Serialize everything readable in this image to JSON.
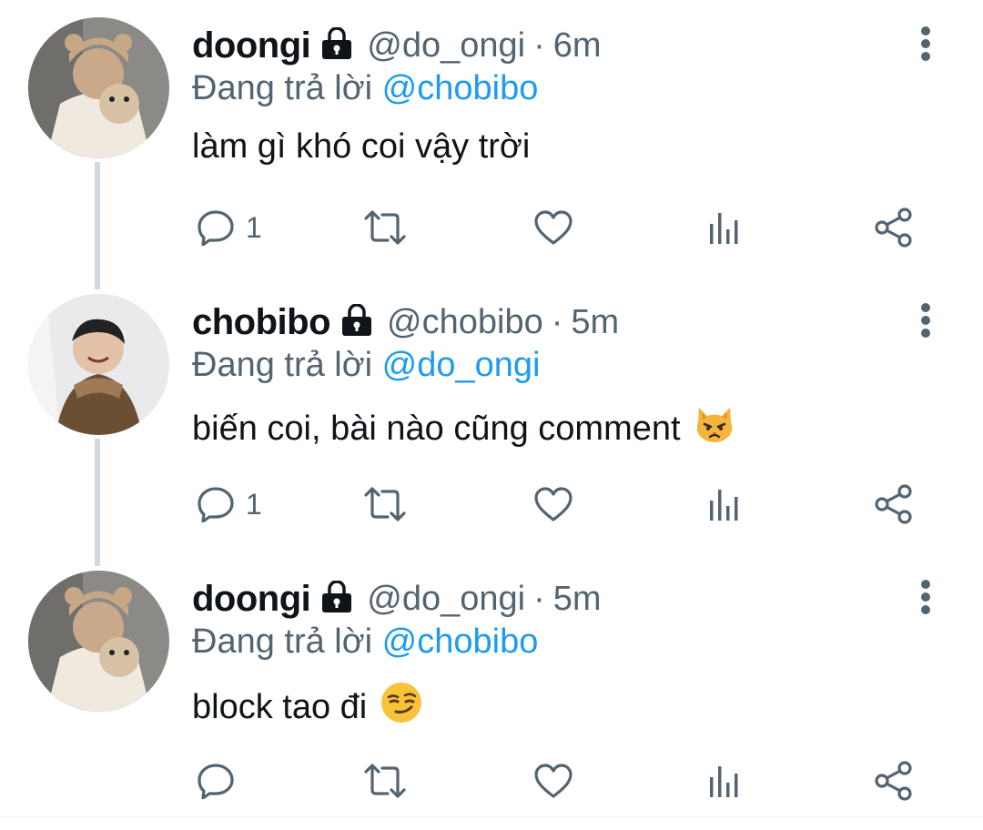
{
  "colors": {
    "text_primary": "#0f1419",
    "text_secondary": "#536471",
    "accent": "#1d9bf0",
    "thread_line": "#cfd9de"
  },
  "tweets": [
    {
      "name": "doongi",
      "handle": "@do_ongi",
      "separator": "·",
      "time": "6m",
      "reply_prefix": "Đang trả lời",
      "reply_to": "@chobibo",
      "text": "làm gì khó coi vậy trời",
      "emoji": "",
      "reply_count": "1",
      "protected_icon": "lock-icon"
    },
    {
      "name": "chobibo",
      "handle": "@chobibo",
      "separator": "·",
      "time": "5m",
      "reply_prefix": "Đang trả lời",
      "reply_to": "@do_ongi",
      "text": "biến coi, bài nào cũng comment",
      "emoji": "pouting-cat-emoji",
      "reply_count": "1",
      "protected_icon": "lock-icon"
    },
    {
      "name": "doongi",
      "handle": "@do_ongi",
      "separator": "·",
      "time": "5m",
      "reply_prefix": "Đang trả lời",
      "reply_to": "@chobibo",
      "text": "block tao đi",
      "emoji": "smirking-face-emoji",
      "reply_count": "",
      "protected_icon": "lock-icon"
    }
  ]
}
